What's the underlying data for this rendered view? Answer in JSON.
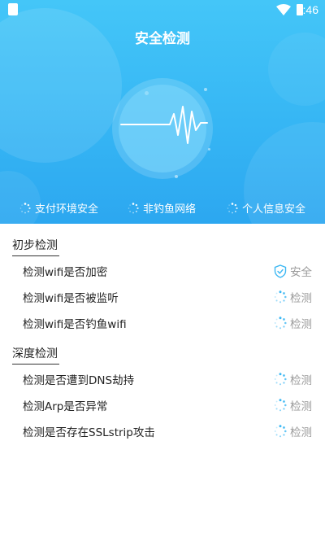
{
  "status_bar": {
    "time": "9:46",
    "wifi_icon": "wifi-icon",
    "battery_icon": "battery-icon"
  },
  "header": {
    "title": "安全检测"
  },
  "hero": {
    "animation_icon": "heartbeat-pulse-icon",
    "chips": [
      {
        "label": "支付环境安全",
        "icon": "loading-spinner-icon"
      },
      {
        "label": "非钓鱼网络",
        "icon": "loading-spinner-icon"
      },
      {
        "label": "个人信息安全",
        "icon": "loading-spinner-icon"
      }
    ]
  },
  "sections": [
    {
      "title": "初步检测",
      "items": [
        {
          "label": "检测wifi是否加密",
          "status": "安全",
          "icon": "shield-check-icon"
        },
        {
          "label": "检测wifi是否被监听",
          "status": "检测",
          "icon": "loading-spinner-icon"
        },
        {
          "label": "检测wifi是否钓鱼wifi",
          "status": "检测",
          "icon": "loading-spinner-icon"
        }
      ]
    },
    {
      "title": "深度检测",
      "items": [
        {
          "label": "检测是否遭到DNS劫持",
          "status": "检测",
          "icon": "loading-spinner-icon"
        },
        {
          "label": "检测Arp是否异常",
          "status": "检测",
          "icon": "loading-spinner-icon"
        },
        {
          "label": "检测是否存在SSLstrip攻击",
          "status": "检测",
          "icon": "loading-spinner-icon"
        }
      ]
    }
  ],
  "colors": {
    "hero_top": "#44c6f8",
    "hero_bottom": "#2ca7f0",
    "spinner": "#3db8f3",
    "status_text": "#9a9a9a"
  }
}
